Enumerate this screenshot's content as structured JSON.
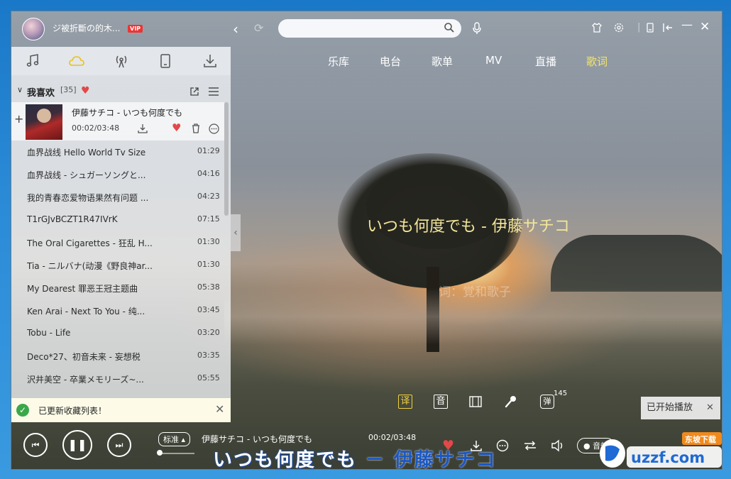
{
  "user": {
    "name": "ジ被折斷の的木...",
    "vip_badge": "VIP"
  },
  "search": {
    "placeholder": ""
  },
  "top_nav": [
    "乐库",
    "电台",
    "歌单",
    "MV",
    "直播",
    "歌词"
  ],
  "top_nav_active": "歌词",
  "sidebar": {
    "tabs": [
      "music-note-icon",
      "cloud-icon",
      "radio-icon",
      "phone-icon",
      "download-icon"
    ],
    "active_tab": "cloud-icon",
    "list_title": "我喜欢",
    "list_count": "[35]",
    "current": {
      "title": "伊藤サチコ - いつも何度でも",
      "time": "00:02/03:48"
    },
    "songs": [
      {
        "name": "血界战线 Hello World Tv Size",
        "duration": "01:29"
      },
      {
        "name": "血界战线 - シュガーソングと...",
        "duration": "04:16"
      },
      {
        "name": "我的青春恋爱物语果然有问题 ...",
        "duration": "04:23"
      },
      {
        "name": "T1rGJvBCZT1R47IVrK",
        "duration": "07:15"
      },
      {
        "name": "The Oral Cigarettes - 狂乱 H...",
        "duration": "01:30"
      },
      {
        "name": "Tia - ニルバナ(动漫《野良神ar...",
        "duration": "01:30"
      },
      {
        "name": "My Dearest 罪恶王冠主题曲",
        "duration": "05:38"
      },
      {
        "name": "Ken Arai - Next To You - 纯...",
        "duration": "03:45"
      },
      {
        "name": "Tobu - Life",
        "duration": "03:20"
      },
      {
        "name": "Deco*27、初音未来 - 妄想税",
        "duration": "03:35"
      },
      {
        "name": "沢井美空 - 卒業メモリーズ~...",
        "duration": "05:55"
      }
    ]
  },
  "toast": {
    "text": "已更新收藏列表！"
  },
  "lyrics": {
    "current_line": "いつも何度でも - 伊藤サチコ",
    "next_line": "词：覚和歌子"
  },
  "lyric_tools": {
    "translate": "译",
    "phonetic": "音",
    "danmu": "弹",
    "danmu_count": "145"
  },
  "tooltip": {
    "text": "已开始播放"
  },
  "player": {
    "quality": "标准",
    "now_playing": "伊藤サチコ - いつも何度でも",
    "time": "00:02/03:48",
    "effects_label": "音效",
    "progress": 0.009
  },
  "desktop_lyric": {
    "sung": "いつも何度でも",
    "unsung": " － 伊藤サチコ"
  },
  "watermark": {
    "text": "uzzf.com",
    "sub": "东坡下载"
  },
  "colors": {
    "lyric_highlight": "#f3e69a",
    "active_nav": "#f6e66a",
    "heart": "#e34848",
    "desktop_lyric_blue": "#1b58c4"
  }
}
